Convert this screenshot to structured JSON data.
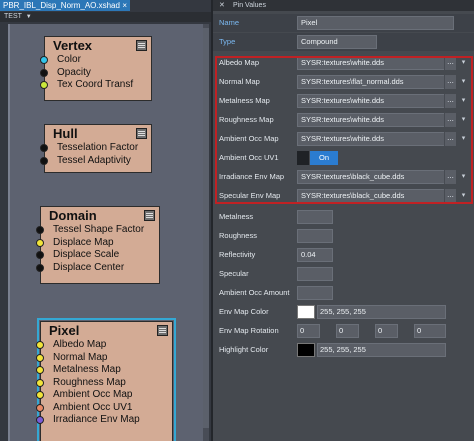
{
  "file_tab": {
    "label": "PBR_IBL_Disp_Norm_AO.xshad",
    "close": "×"
  },
  "graph_tab": {
    "label": "TEST"
  },
  "nodes": {
    "vertex": {
      "title": "Vertex",
      "ports": [
        "Color",
        "Opacity",
        "Tex Coord Transf"
      ]
    },
    "hull": {
      "title": "Hull",
      "ports": [
        "Tesselation Factor",
        "Tessel Adaptivity"
      ]
    },
    "domain": {
      "title": "Domain",
      "ports": [
        "Tessel Shape Factor",
        "Displace Map",
        "Displace Scale",
        "Displace Center"
      ]
    },
    "pixel": {
      "title": "Pixel",
      "ports": [
        "Albedo Map",
        "Normal Map",
        "Metalness Map",
        "Roughness Map",
        "Ambient Occ Map",
        "Ambient Occ UV1",
        "Irradiance Env Map"
      ]
    }
  },
  "pin_values": {
    "header": "Pin Values",
    "name_label": "Name",
    "name_value": "Pixel",
    "type_label": "Type",
    "type_value": "Compound",
    "albedo": {
      "label": "Albedo Map",
      "value": "SYSR:textures\\white.dds"
    },
    "normal": {
      "label": "Normal Map",
      "value": "SYSR:textures\\flat_normal.dds"
    },
    "metalness_map": {
      "label": "Metalness Map",
      "value": "SYSR:textures\\white.dds"
    },
    "roughness_map": {
      "label": "Roughness Map",
      "value": "SYSR:textures\\white.dds"
    },
    "ao_map": {
      "label": "Ambient Occ Map",
      "value": "SYSR:textures\\white.dds"
    },
    "ao_uv1": {
      "label": "Ambient Occ UV1",
      "value": "On"
    },
    "irradiance": {
      "label": "Irradiance Env Map",
      "value": "SYSR:textures\\black_cube.dds"
    },
    "specular_env": {
      "label": "Specular Env Map",
      "value": "SYSR:textures\\black_cube.dds"
    },
    "metalness": {
      "label": "Metalness"
    },
    "roughness": {
      "label": "Roughness"
    },
    "reflectivity": {
      "label": "Reflectivity",
      "value": "0.04"
    },
    "specular": {
      "label": "Specular"
    },
    "ao_amount": {
      "label": "Ambient Occ Amount"
    },
    "env_map_color": {
      "label": "Env Map Color",
      "value": "255, 255, 255"
    },
    "env_map_rotation": {
      "label": "Env Map Rotation",
      "values": [
        "0",
        "0",
        "0",
        "0"
      ]
    },
    "highlight_color": {
      "label": "Highlight Color",
      "value": "255, 255, 255"
    },
    "browse": "...",
    "dropdown": "▾"
  },
  "colors": {
    "accent_blue": "#2b7cd0",
    "highlight_red": "#c02124",
    "node_fill": "#d3ab95",
    "port_cyan": "#33c4ea",
    "port_black": "#111111",
    "port_lime": "#cbe83b",
    "port_yellow": "#f1e43a",
    "port_salmon": "#e88a66",
    "port_purple": "#7a5cd6",
    "selection": "#34a8d4"
  }
}
